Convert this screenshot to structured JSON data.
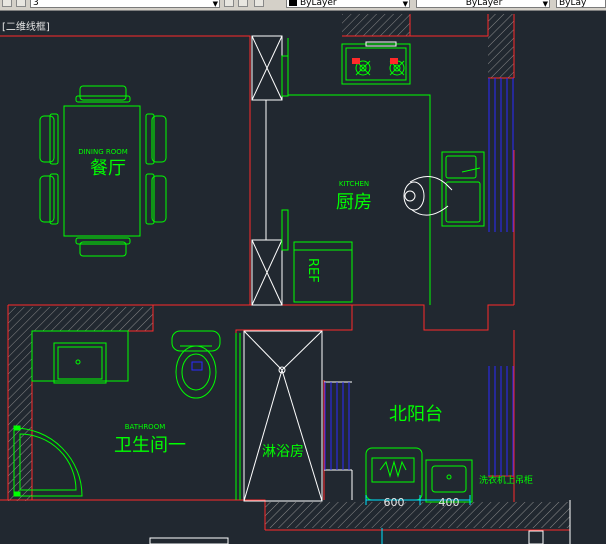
{
  "toolbar": {
    "layer_value": "3",
    "color_value": "ByLayer",
    "linetype_value": "ByLayer",
    "lineweight_value": "ByLay"
  },
  "viewport_label": "[二维线框]",
  "rooms": {
    "dining_en": "DINING ROOM",
    "dining_cn": "餐厅",
    "kitchen_en": "KITCHEN",
    "kitchen_cn": "厨房",
    "bathroom_en": "BATHROOM",
    "bathroom_cn": "卫生间一",
    "shower_cn": "淋浴房",
    "balcony_cn": "北阳台"
  },
  "fixtures": {
    "fridge": "REF",
    "washer_note": "洗衣机上吊柜",
    "dim_a": "600",
    "dim_b": "400"
  },
  "colors": {
    "background": "#212830",
    "wall": "#ff2a2a",
    "fixture": "#00ff00",
    "outline": "#ffffff",
    "window": "#2a2aff",
    "hatch": "#8a8a8a",
    "dimension": "#00e5ff"
  }
}
